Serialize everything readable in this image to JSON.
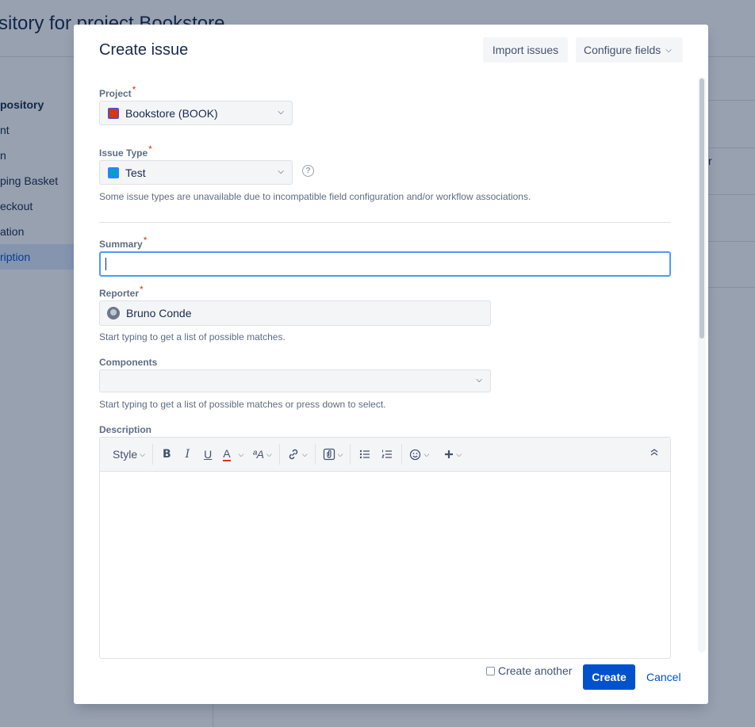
{
  "background": {
    "page_title": "sitory for project Bookstore",
    "sidebar_title": "pository",
    "sidebar_items": [
      "nt",
      "n",
      "ping Basket",
      "eckout",
      "ation",
      "ription"
    ],
    "right_text": "r"
  },
  "modal": {
    "title": "Create issue",
    "import_label": "Import issues",
    "configure_label": "Configure fields"
  },
  "form": {
    "project": {
      "label": "Project",
      "value": "Bookstore (BOOK)"
    },
    "issue_type": {
      "label": "Issue Type",
      "value": "Test",
      "hint": "Some issue types are unavailable due to incompatible field configuration and/or workflow associations."
    },
    "summary": {
      "label": "Summary",
      "value": ""
    },
    "reporter": {
      "label": "Reporter",
      "value": "Bruno Conde",
      "hint": "Start typing to get a list of possible matches."
    },
    "components": {
      "label": "Components",
      "value": "",
      "hint": "Start typing to get a list of possible matches or press down to select."
    },
    "description": {
      "label": "Description",
      "toolbar": {
        "style": "Style",
        "bold": "B",
        "italic": "I",
        "underline": "U",
        "color": "A",
        "size": "ªA"
      }
    }
  },
  "footer": {
    "create_another_label": "Create another",
    "create_label": "Create",
    "cancel_label": "Cancel"
  },
  "colors": {
    "primary": "#0052cc",
    "focus": "#4c9aff",
    "required": "#de350b"
  },
  "icons": [
    "help-icon",
    "chevron-down-icon",
    "link-icon",
    "attachment-icon",
    "bullet-list-icon",
    "numbered-list-icon",
    "emoji-icon",
    "plus-icon",
    "collapse-icon"
  ]
}
